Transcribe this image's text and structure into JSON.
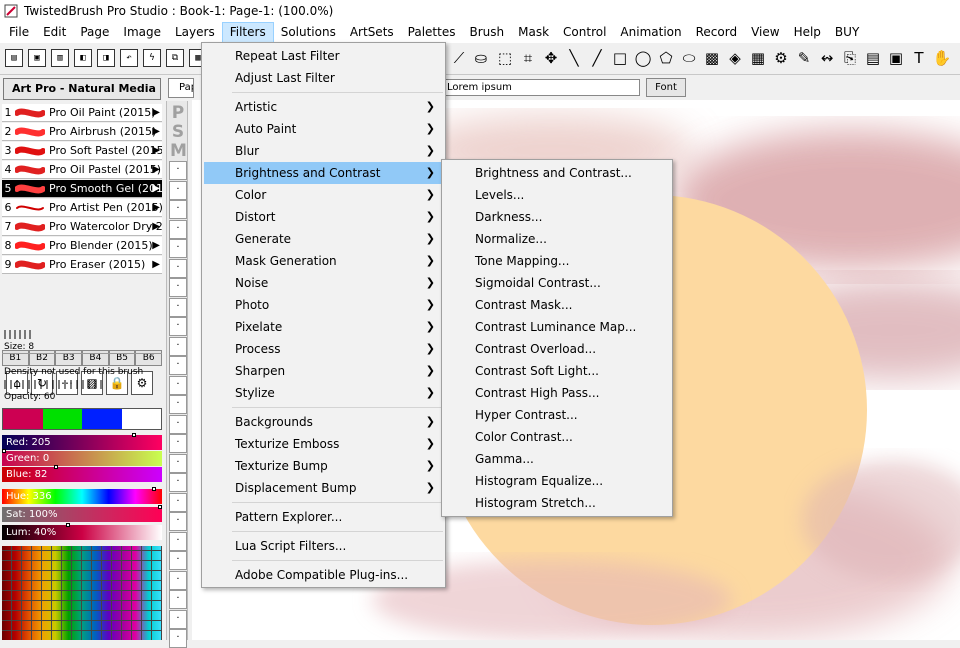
{
  "app": {
    "title": "TwistedBrush Pro Studio : Book-1: Page-1:  (100.0%)"
  },
  "menubar": [
    "File",
    "Edit",
    "Page",
    "Image",
    "Layers",
    "Filters",
    "Solutions",
    "ArtSets",
    "Palettes",
    "Brush",
    "Mask",
    "Control",
    "Animation",
    "Record",
    "View",
    "Help",
    "BUY"
  ],
  "brush_panel": {
    "artset": "Art Pro - Natural Media (20",
    "brushes": [
      {
        "num": "1",
        "name": "Pro Oil Paint (2015)"
      },
      {
        "num": "2",
        "name": "Pro Airbrush (2015)"
      },
      {
        "num": "3",
        "name": "Pro Soft Pastel (2015"
      },
      {
        "num": "4",
        "name": "Pro Oil Pastel (2015)"
      },
      {
        "num": "5",
        "name": "Pro Smooth Gel (201"
      },
      {
        "num": "6",
        "name": "Pro Artist Pen (2015)"
      },
      {
        "num": "7",
        "name": "Pro Watercolor Dry 2"
      },
      {
        "num": "8",
        "name": "Pro Blender (2015)"
      },
      {
        "num": "9",
        "name": "Pro Eraser (2015)"
      }
    ],
    "selected_index": 4,
    "tabs": [
      "B1",
      "B2",
      "B3",
      "B4",
      "B5",
      "B6"
    ],
    "size_label": "Size: 8",
    "density_label": "Density not used for this brush",
    "opacity_label": "Opacity: 60",
    "color_labels": {
      "red": "Red: 205",
      "green": "Green: 0",
      "blue": "Blue: 82",
      "hue": "Hue: 336",
      "sat": "Sat: 100%",
      "lum": "Lum: 40%"
    },
    "psm_letters": [
      "P",
      "S",
      "M"
    ]
  },
  "toolbar_text": {
    "paper_tab": "Pap",
    "font_sample": "Lorem ipsum",
    "font_button": "Font"
  },
  "filters_menu": [
    {
      "label": "Repeat Last Filter",
      "sub": false
    },
    {
      "label": "Adjust Last Filter",
      "sub": false
    },
    {
      "label": "Artistic",
      "sub": true
    },
    {
      "label": "Auto Paint",
      "sub": true
    },
    {
      "label": "Blur",
      "sub": true
    },
    {
      "label": "Brightness and Contrast",
      "sub": true
    },
    {
      "label": "Color",
      "sub": true
    },
    {
      "label": "Distort",
      "sub": true
    },
    {
      "label": "Generate",
      "sub": true
    },
    {
      "label": "Mask Generation",
      "sub": true
    },
    {
      "label": "Noise",
      "sub": true
    },
    {
      "label": "Photo",
      "sub": true
    },
    {
      "label": "Pixelate",
      "sub": true
    },
    {
      "label": "Process",
      "sub": true
    },
    {
      "label": "Sharpen",
      "sub": true
    },
    {
      "label": "Stylize",
      "sub": true
    },
    {
      "label": "Backgrounds",
      "sub": true
    },
    {
      "label": "Texturize Emboss",
      "sub": true
    },
    {
      "label": "Texturize Bump",
      "sub": true
    },
    {
      "label": "Displacement Bump",
      "sub": true
    },
    {
      "label": "Pattern Explorer...",
      "sub": false
    },
    {
      "label": "Lua Script Filters...",
      "sub": false
    },
    {
      "label": "Adobe Compatible Plug-ins...",
      "sub": false
    }
  ],
  "brightness_submenu": [
    "Brightness and Contrast...",
    "Levels...",
    "Darkness...",
    "Normalize...",
    "Tone Mapping...",
    "Sigmoidal Contrast...",
    "Contrast Mask...",
    "Contrast Luminance Map...",
    "Contrast Overload...",
    "Contrast Soft Light...",
    "Contrast High Pass...",
    "Hyper Contrast...",
    "Color Contrast...",
    "Gamma...",
    "Histogram Equalize...",
    "Histogram Stretch..."
  ],
  "colors": {
    "highlight": "#91c9f7",
    "swatch_primary": "#cd0052",
    "sun": "#fdd9a0",
    "wash": "#d9a3a6"
  }
}
